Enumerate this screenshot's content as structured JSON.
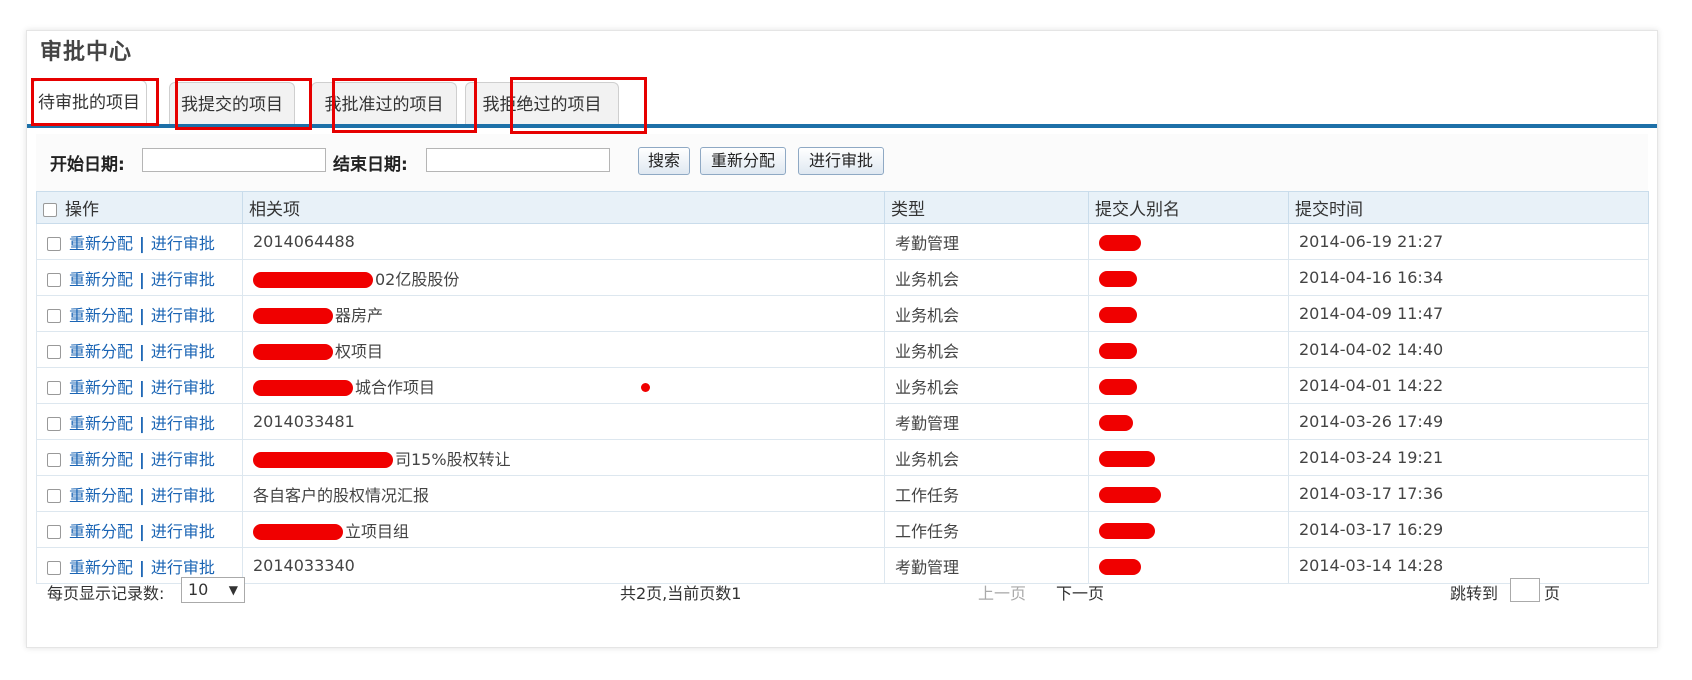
{
  "page": {
    "title": "审批中心"
  },
  "tabs": [
    {
      "label": "待审批的项目",
      "active": true
    },
    {
      "label": "我提交的项目",
      "active": false
    },
    {
      "label": "我批准过的项目",
      "active": false
    },
    {
      "label": "我拒绝过的项目",
      "active": false
    }
  ],
  "filter": {
    "start_label": "开始日期:",
    "end_label": "结束日期:",
    "start_value": "",
    "end_value": "",
    "search_label": "搜索",
    "reassign_label": "重新分配",
    "approve_label": "进行审批"
  },
  "table": {
    "headers": [
      "操作",
      "相关项",
      "类型",
      "提交人别名",
      "提交时间"
    ],
    "action_reassign": "重新分配",
    "action_approve": "进行审批",
    "action_sep": "|",
    "rows": [
      {
        "item": "2014064488",
        "type": "考勤管理",
        "time": "2014-06-19 21:27"
      },
      {
        "item": "02亿股股份",
        "type": "业务机会",
        "time": "2014-04-16 16:34"
      },
      {
        "item": "器房产",
        "type": "业务机会",
        "time": "2014-04-09 11:47"
      },
      {
        "item": "权项目",
        "type": "业务机会",
        "time": "2014-04-02 14:40"
      },
      {
        "item": "城合作项目",
        "type": "业务机会",
        "time": "2014-04-01 14:22"
      },
      {
        "item": "2014033481",
        "type": "考勤管理",
        "time": "2014-03-26 17:49"
      },
      {
        "item": "司15%股权转让",
        "type": "业务机会",
        "time": "2014-03-24 19:21"
      },
      {
        "item": "各自客户的股权情况汇报",
        "type": "工作任务",
        "time": "2014-03-17 17:36"
      },
      {
        "item": "立项目组",
        "type": "工作任务",
        "time": "2014-03-17 16:29"
      },
      {
        "item": "2014033340",
        "type": "考勤管理",
        "time": "2014-03-14 14:28"
      }
    ]
  },
  "footer": {
    "per_page_label": "每页显示记录数:",
    "per_page_value": "10",
    "page_info": "共2页,当前页数1",
    "prev_label": "上一页",
    "next_label": "下一页",
    "jump_label": "跳转到",
    "jump_suffix": "页"
  },
  "colors": {
    "accent": "#1d70a8",
    "link": "#1a64b4",
    "highlight": "#e60000"
  }
}
